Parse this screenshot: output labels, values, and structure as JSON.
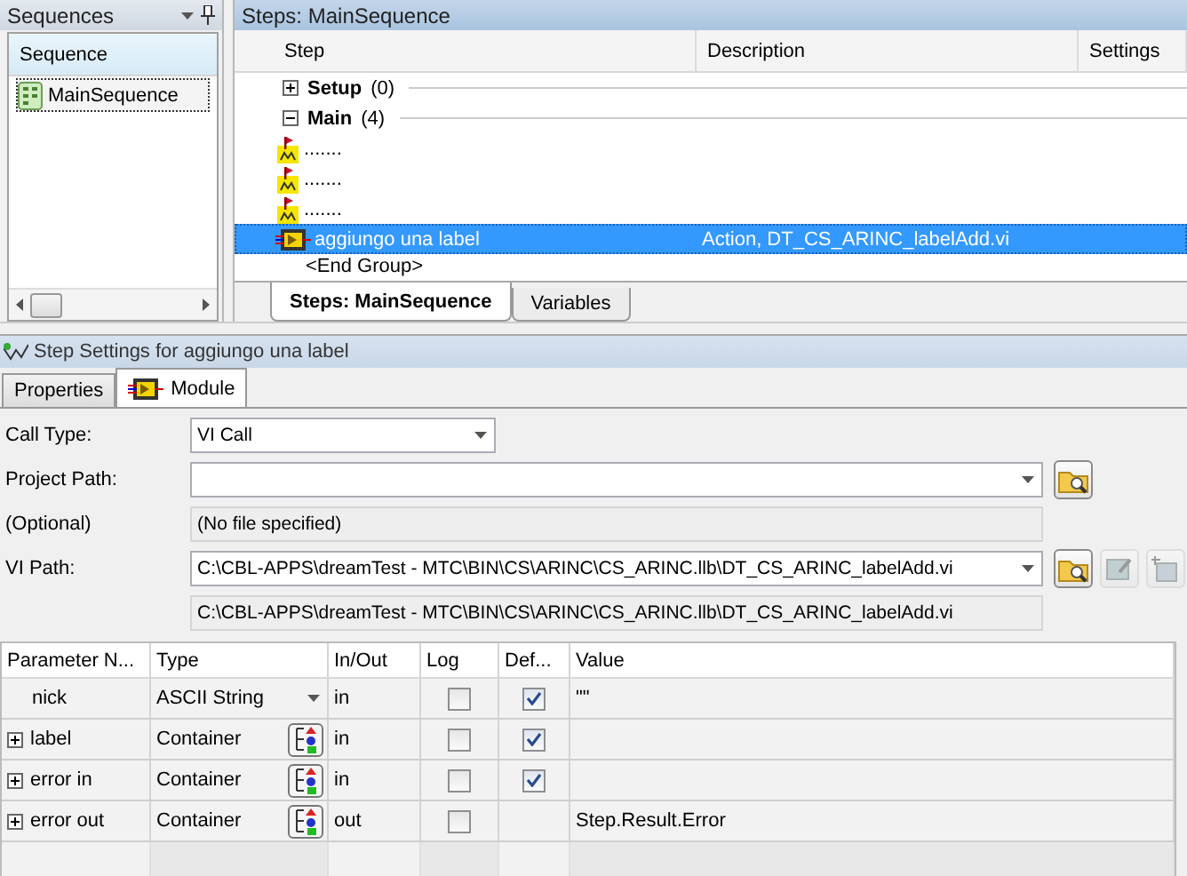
{
  "sequences_panel": {
    "title": "Sequences",
    "column": "Sequence",
    "items": [
      {
        "label": "MainSequence",
        "selected": true
      }
    ]
  },
  "steps_panel": {
    "title": "Steps: MainSequence",
    "columns": [
      "Step",
      "Description",
      "Settings"
    ],
    "groups": [
      {
        "label": "Setup",
        "count": "(0)",
        "expanded": false
      },
      {
        "label": "Main",
        "count": "(4)",
        "expanded": true,
        "steps": [
          {
            "kind": "flag",
            "name": ".......",
            "selected": false
          },
          {
            "kind": "flag",
            "name": ".......",
            "selected": false
          },
          {
            "kind": "flag",
            "name": ".......",
            "selected": false
          },
          {
            "kind": "vi",
            "name": "aggiungo una label",
            "description": "Action,  DT_CS_ARINC_labelAdd.vi",
            "selected": true
          }
        ]
      }
    ],
    "end_group": "<End Group>",
    "tabs": [
      {
        "label": "Steps: MainSequence",
        "selected": true
      },
      {
        "label": "Variables",
        "selected": false
      }
    ]
  },
  "step_settings": {
    "title": "Step Settings for aggiungo una label",
    "tabs": [
      {
        "label": "Properties",
        "selected": false,
        "icon": false
      },
      {
        "label": "Module",
        "selected": true,
        "icon": true
      }
    ],
    "call_type": {
      "label": "Call Type:",
      "value": "VI Call"
    },
    "project_path": {
      "label": "Project Path:",
      "note_label": "(Optional)",
      "note": "(No file specified)"
    },
    "vi_path": {
      "label": "VI Path:",
      "value": "C:\\CBL-APPS\\dreamTest - MTC\\BIN\\CS\\ARINC\\CS_ARINC.llb\\DT_CS_ARINC_labelAdd.vi",
      "resolved": "C:\\CBL-APPS\\dreamTest - MTC\\BIN\\CS\\ARINC\\CS_ARINC.llb\\DT_CS_ARINC_labelAdd.vi",
      "buttons": [
        {
          "kind": "browse",
          "disabled": false
        },
        {
          "kind": "edit",
          "disabled": true
        },
        {
          "kind": "new",
          "disabled": true
        }
      ]
    },
    "parameters": {
      "columns": [
        "Parameter N...",
        "Type",
        "In/Out",
        "Log",
        "Def...",
        "Value"
      ],
      "rows": [
        {
          "name": "nick",
          "expandable": false,
          "type": "ASCII String",
          "kind": "string",
          "inout": "in",
          "log": false,
          "default": true,
          "value": "\"\""
        },
        {
          "name": "label",
          "expandable": true,
          "type": "Container",
          "kind": "container",
          "inout": "in",
          "log": false,
          "default": true
        },
        {
          "name": "error in",
          "expandable": true,
          "type": "Container",
          "kind": "container",
          "inout": "in",
          "log": false,
          "default": true
        },
        {
          "name": "error out",
          "expandable": true,
          "type": "Container",
          "kind": "container",
          "inout": "out",
          "log": false,
          "value": "Step.Result.Error"
        }
      ]
    }
  }
}
